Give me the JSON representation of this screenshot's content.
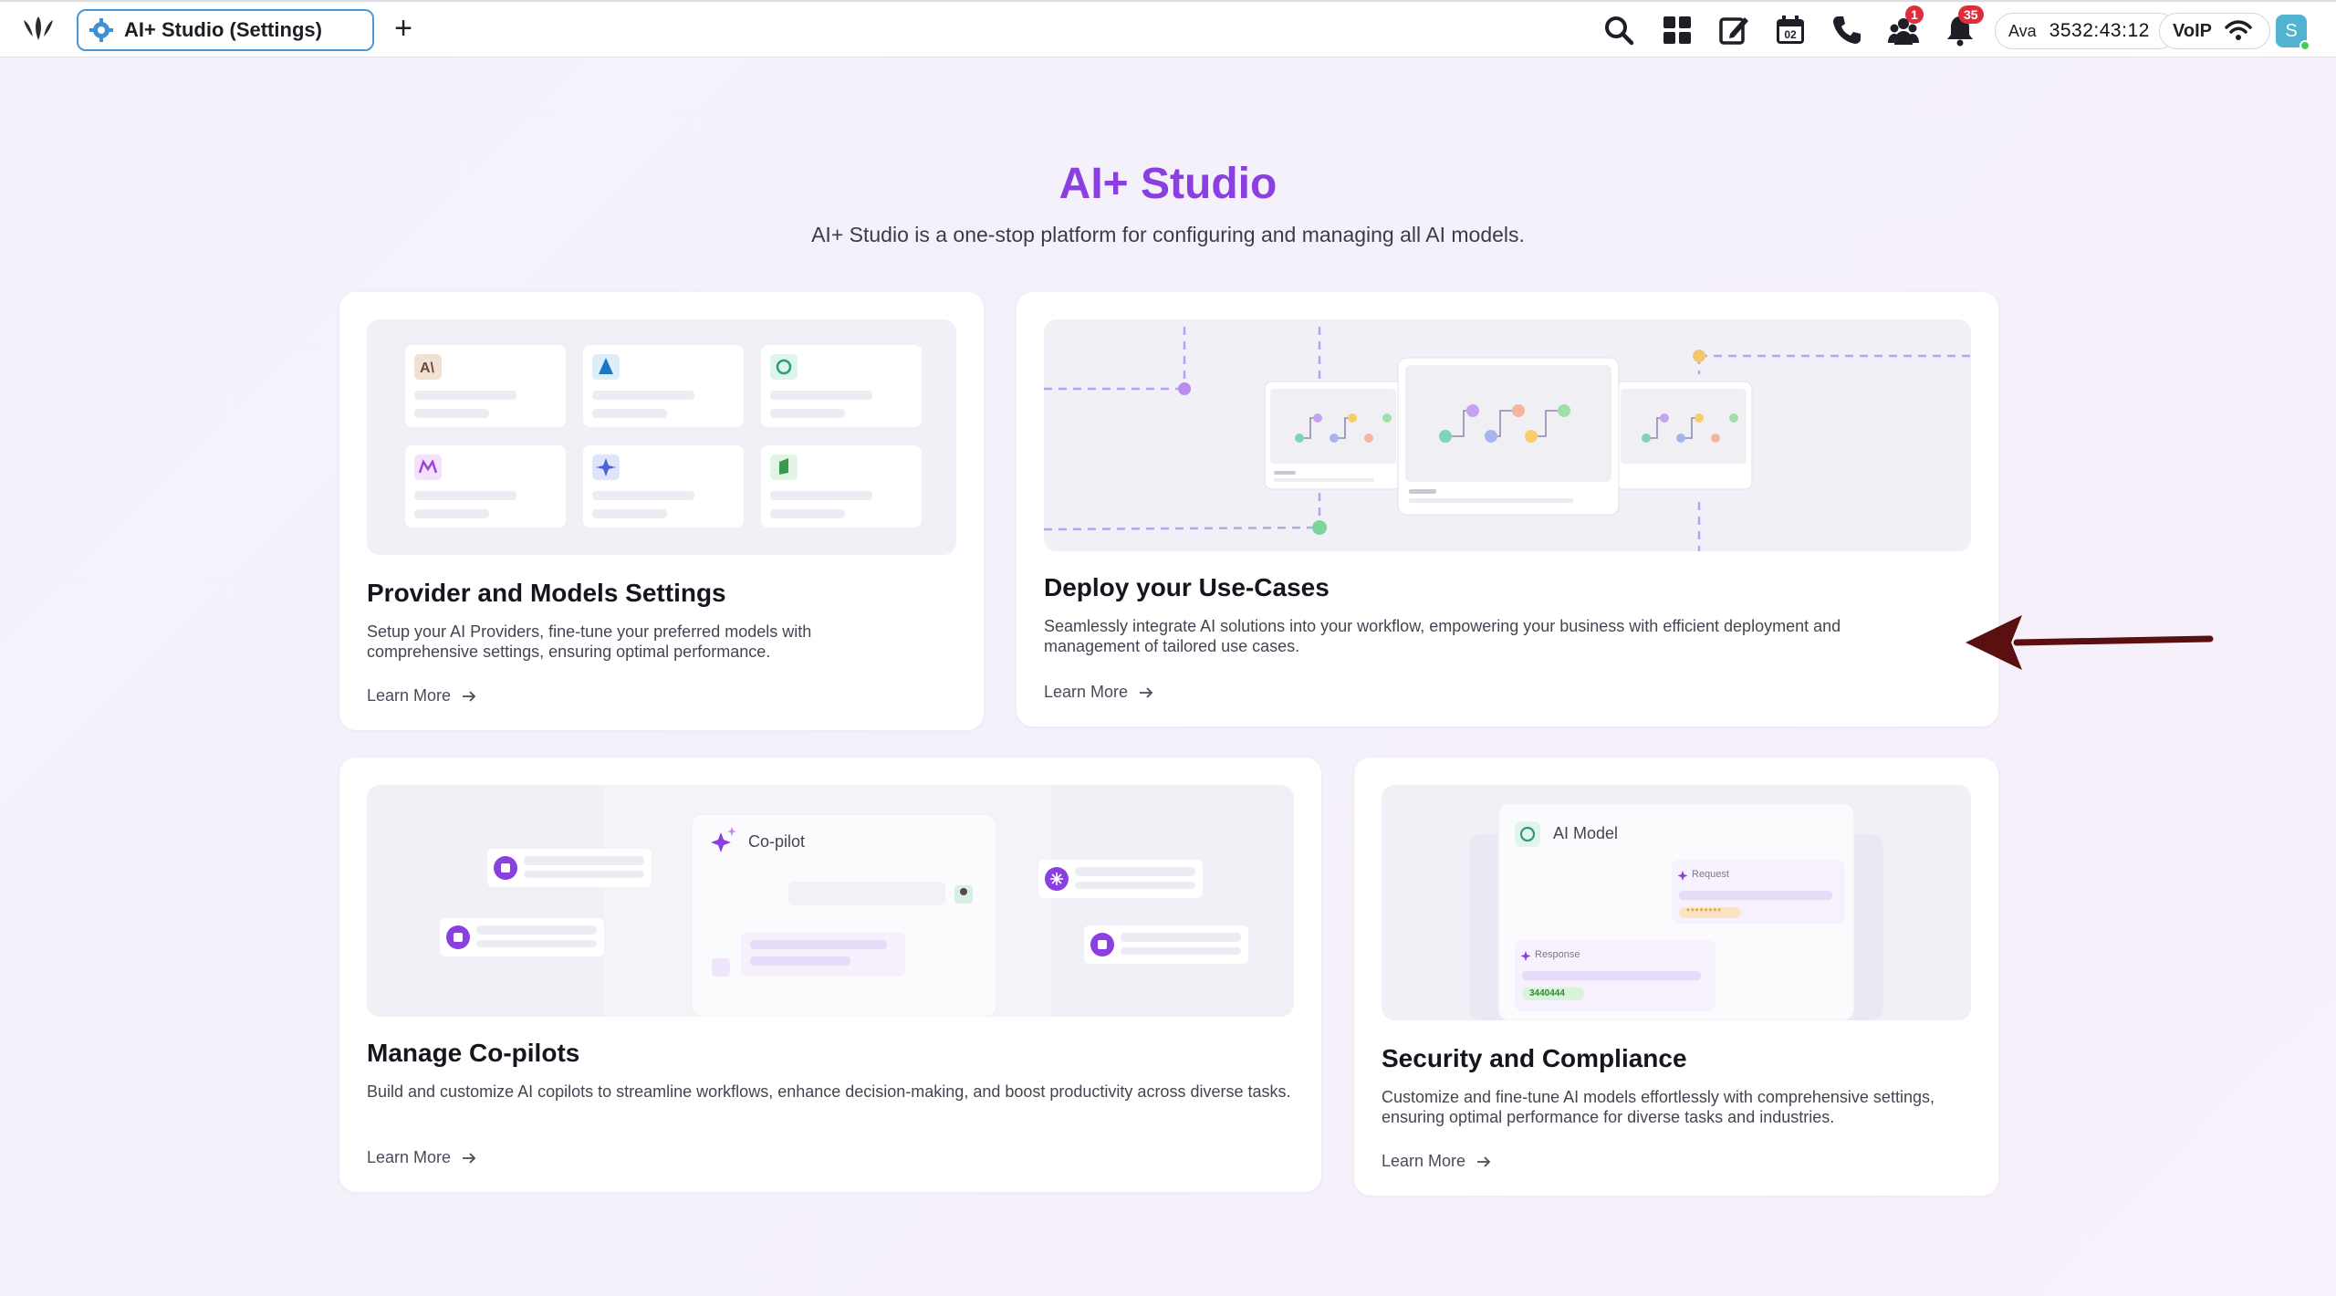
{
  "topbar": {
    "tab_title": "AI+ Studio (Settings)",
    "notifications_badge": "35",
    "alerts_badge": "1",
    "calendar_day": "02",
    "agent_name": "Ava",
    "agent_timer": "3532:43:12",
    "voip_label": "VoIP",
    "avatar_initial": "S",
    "icons": [
      "logo-icon",
      "gear-icon",
      "plus-icon",
      "search-icon",
      "apps-grid-icon",
      "compose-icon",
      "calendar-icon",
      "phone-icon",
      "team-icon",
      "bell-icon",
      "wifi-icon"
    ]
  },
  "header": {
    "title": "AI+ Studio",
    "subtitle": "AI+ Studio is a one-stop platform for configuring and managing all AI models."
  },
  "cards": [
    {
      "title": "Provider and Models Settings",
      "description": "Setup your AI Providers, fine-tune your preferred models with comprehensive settings, ensuring optimal performance.",
      "link": "Learn More"
    },
    {
      "title": "Deploy your Use-Cases",
      "description": "Seamlessly integrate AI solutions into your workflow, empowering your business with efficient deployment and management of tailored use cases.",
      "link": "Learn More"
    },
    {
      "title": "Manage Co-pilots",
      "description": "Build and customize AI copilots to streamline workflows, enhance decision-making, and boost productivity across diverse tasks.",
      "link": "Learn More",
      "illustration_label": "Co-pilot"
    },
    {
      "title": "Security and Compliance",
      "description": "Customize and fine-tune AI models effortlessly with comprehensive settings, ensuring optimal performance for diverse tasks and industries.",
      "link": "Learn More",
      "illustration_label": "AI Model",
      "request_label": "Request",
      "response_label": "Response",
      "masked_value": "********",
      "response_value": "3440444"
    }
  ],
  "colors": {
    "accent": "#8a3fe0",
    "tab_border": "#4a97d8",
    "badge": "#e02d3c",
    "annotation_arrow": "#5a0f10"
  }
}
